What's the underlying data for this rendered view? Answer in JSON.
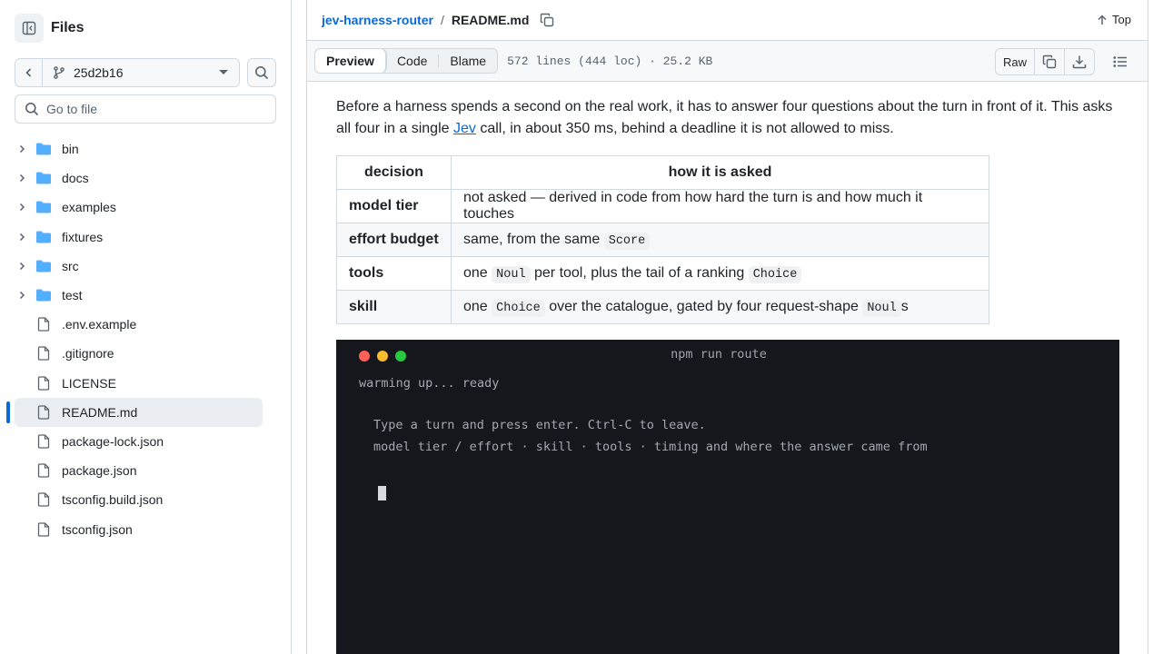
{
  "sidebar": {
    "title": "Files",
    "branch": "25d2b16",
    "goto_placeholder": "Go to file",
    "items": [
      {
        "type": "folder",
        "label": "bin"
      },
      {
        "type": "folder",
        "label": "docs"
      },
      {
        "type": "folder",
        "label": "examples"
      },
      {
        "type": "folder",
        "label": "fixtures"
      },
      {
        "type": "folder",
        "label": "src"
      },
      {
        "type": "folder",
        "label": "test"
      },
      {
        "type": "file",
        "label": ".env.example"
      },
      {
        "type": "file",
        "label": ".gitignore"
      },
      {
        "type": "file",
        "label": "LICENSE"
      },
      {
        "type": "file",
        "label": "README.md",
        "active": true
      },
      {
        "type": "file",
        "label": "package-lock.json"
      },
      {
        "type": "file",
        "label": "package.json"
      },
      {
        "type": "file",
        "label": "tsconfig.build.json"
      },
      {
        "type": "file",
        "label": "tsconfig.json"
      }
    ]
  },
  "breadcrumb": {
    "repo": "jev-harness-router",
    "separator": "/",
    "file": "README.md",
    "top_label": "Top"
  },
  "file_bar": {
    "tabs": [
      "Preview",
      "Code",
      "Blame"
    ],
    "meta": "572 lines (444 loc) · 25.2 KB",
    "raw_label": "Raw"
  },
  "readme": {
    "intro_before": "Before a harness spends a second on the real work, it has to answer four questions about the turn in front of it. This asks all four in a single ",
    "intro_link": "Jev",
    "intro_after": " call, in about 350 ms, behind a deadline it is not allowed to miss.",
    "table": {
      "headers": [
        "decision",
        "how it is asked"
      ],
      "rows": [
        {
          "key": "model tier",
          "parts": [
            {
              "t": "not asked — derived in code from how hard the turn is and how much it touches"
            }
          ]
        },
        {
          "key": "effort budget",
          "parts": [
            {
              "t": "same, from the same "
            },
            {
              "c": "Score"
            }
          ]
        },
        {
          "key": "tools",
          "parts": [
            {
              "t": "one "
            },
            {
              "c": "Noul"
            },
            {
              "t": " per tool, plus the tail of a ranking "
            },
            {
              "c": "Choice"
            }
          ]
        },
        {
          "key": "skill",
          "parts": [
            {
              "t": "one "
            },
            {
              "c": "Choice"
            },
            {
              "t": " over the catalogue, gated by four request-shape "
            },
            {
              "c": "Noul"
            },
            {
              "t": "s"
            }
          ]
        }
      ]
    }
  },
  "terminal": {
    "title": "npm run route",
    "dot_colors": [
      "#ff5f57",
      "#febc2e",
      "#28c840"
    ],
    "lines": [
      "warming up... ready",
      "Type a turn and press enter. Ctrl-C to leave.",
      "model tier / effort · skill · tools · timing and where the answer came from"
    ]
  },
  "colors": {
    "accent": "#0969da",
    "folder": "#54aeff",
    "border": "#d1d9e0",
    "terminal_bg": "#16171d"
  }
}
